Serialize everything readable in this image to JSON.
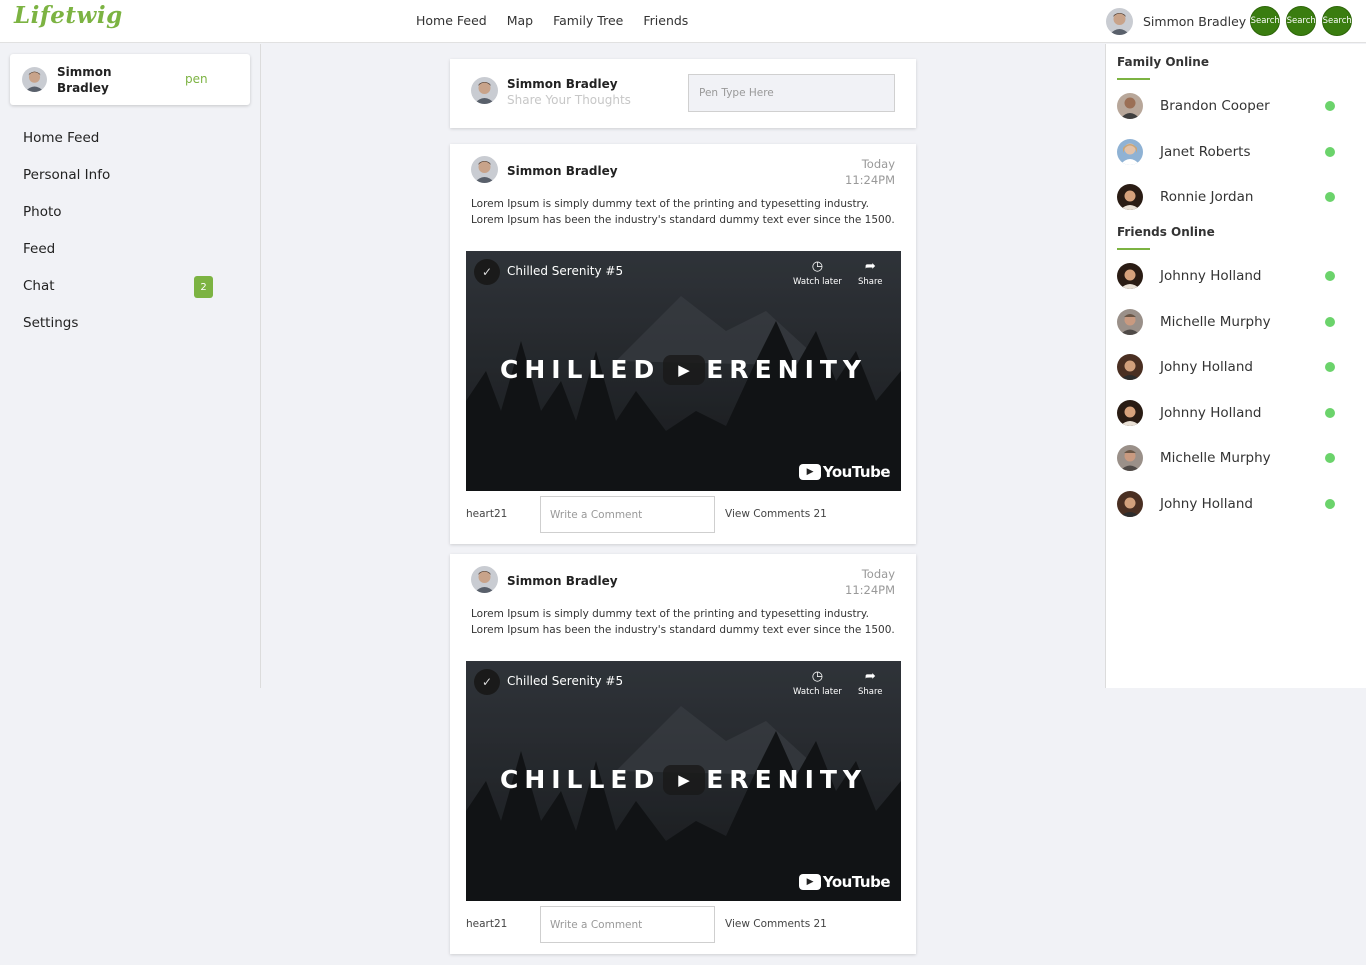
{
  "app": {
    "logo": "Lifetwig"
  },
  "topnav": {
    "items": [
      "Home Feed",
      "Map",
      "Family Tree",
      "Friends"
    ]
  },
  "user": {
    "name": "Simmon Bradley"
  },
  "search_buttons": [
    "Search",
    "Search",
    "Search"
  ],
  "left_sidebar": {
    "profile_name": "Simmon Bradley",
    "pen_label": "pen",
    "menu": [
      {
        "label": "Home Feed"
      },
      {
        "label": "Personal Info"
      },
      {
        "label": "Photo"
      },
      {
        "label": "Feed"
      },
      {
        "label": "Chat",
        "badge": "2"
      },
      {
        "label": "Settings"
      }
    ]
  },
  "composer": {
    "name": "Simmon Bradley",
    "subtitle": "Share Your Thoughts",
    "placeholder": "Pen Type Here"
  },
  "posts": [
    {
      "author": "Simmon Bradley",
      "day": "Today",
      "time": "11:24PM",
      "text_line1": "Lorem Ipsum is simply dummy text of the printing and typesetting industry.",
      "text_line2": "Lorem Ipsum has been the industry's standard dummy text ever since the 1500.",
      "video": {
        "title": "Chilled Serenity #5",
        "overlay_left": "CHILLED",
        "overlay_right": "ERENITY",
        "watch_later": "Watch later",
        "share": "Share",
        "brand": "YouTube"
      },
      "hearts": "heart21",
      "comment_placeholder": "Write a Comment",
      "view_comments": "View Comments 21"
    },
    {
      "author": "Simmon Bradley",
      "day": "Today",
      "time": "11:24PM",
      "text_line1": "Lorem Ipsum is simply dummy text of the printing and typesetting industry.",
      "text_line2": "Lorem Ipsum has been the industry's standard dummy text ever since the 1500.",
      "video": {
        "title": "Chilled Serenity #5",
        "overlay_left": "CHILLED",
        "overlay_right": "ERENITY",
        "watch_later": "Watch later",
        "share": "Share",
        "brand": "YouTube"
      },
      "hearts": "heart21",
      "comment_placeholder": "Write a Comment",
      "view_comments": "View Comments 21"
    }
  ],
  "right_sidebar": {
    "family_heading": "Family Online",
    "family": [
      {
        "name": "Brandon Cooper"
      },
      {
        "name": "Janet Roberts"
      },
      {
        "name": "Ronnie Jordan"
      }
    ],
    "friends_heading": "Friends Online",
    "friends": [
      {
        "name": "Johnny Holland"
      },
      {
        "name": "Michelle Murphy"
      },
      {
        "name": "Johny Holland"
      },
      {
        "name": "Johnny Holland"
      },
      {
        "name": "Michelle Murphy"
      },
      {
        "name": "Johny Holland"
      }
    ]
  },
  "colors": {
    "accent": "#7cb342",
    "search_button": "#3a7d10",
    "online": "#6bd36b"
  }
}
